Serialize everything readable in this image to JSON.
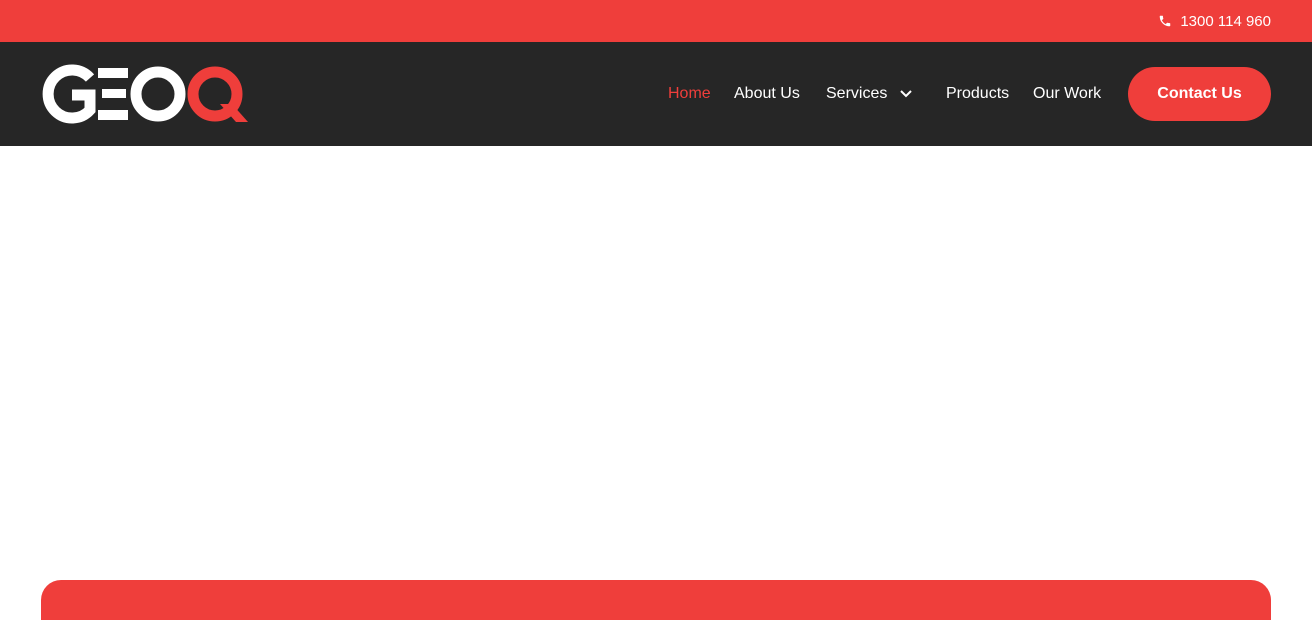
{
  "topbar": {
    "phone_icon": "phone-icon",
    "phone_number": "1300 114 960",
    "background_color": "#ef3e3b"
  },
  "header": {
    "background_color": "#262626",
    "logo": {
      "text_white": "GEO",
      "text_red": "Q"
    },
    "nav": {
      "items": [
        {
          "label": "Home",
          "active": true
        },
        {
          "label": "About Us",
          "active": false
        },
        {
          "label": "Services",
          "active": false,
          "has_dropdown": true,
          "dropdown_icon": "chevron-down-icon"
        },
        {
          "label": "Products",
          "active": false
        },
        {
          "label": "Our Work",
          "active": false
        }
      ]
    },
    "contact_button_label": "Contact Us"
  },
  "colors": {
    "accent": "#ef3e3b",
    "dark": "#262626",
    "white": "#ffffff"
  }
}
